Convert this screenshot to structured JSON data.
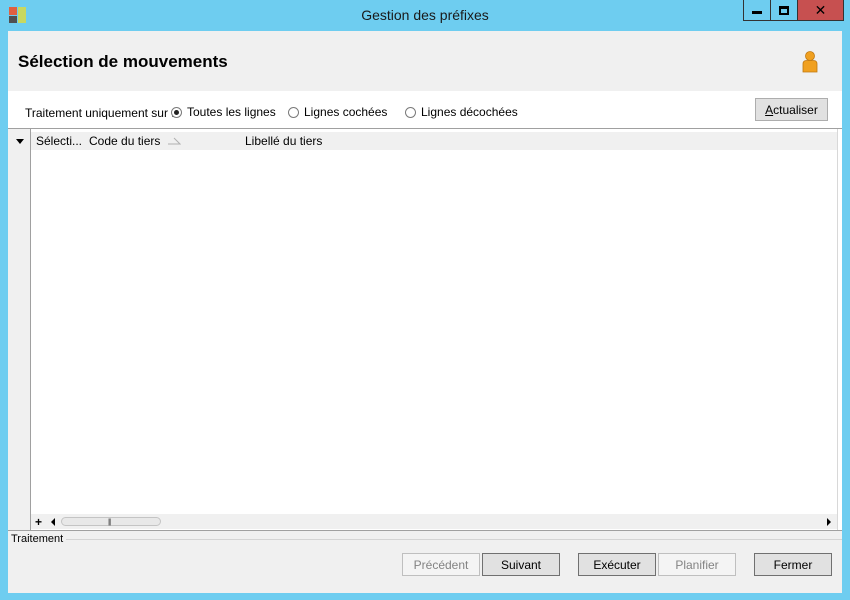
{
  "window": {
    "title": "Gestion des préfixes"
  },
  "header": {
    "title": "Sélection de mouvements",
    "user_icon": "user-icon",
    "user_icon_color": "#f0a020"
  },
  "options": {
    "label": "Traitement uniquement sur :",
    "radios": [
      {
        "label": "Toutes les lignes",
        "selected": true
      },
      {
        "label": "Lignes cochées",
        "selected": false
      },
      {
        "label": "Lignes décochées",
        "selected": false
      }
    ],
    "refresh_label": "Actualiser"
  },
  "grid": {
    "columns": [
      "Sélecti...",
      "Code du tiers",
      "Libellé du tiers"
    ],
    "rows": []
  },
  "status": {
    "label": "Traitement"
  },
  "buttons": {
    "previous": "Précédent",
    "next": "Suivant",
    "execute": "Exécuter",
    "schedule": "Planifier",
    "close": "Fermer"
  },
  "colors": {
    "title_bar": "#6ecdf0",
    "close_button": "#c75050"
  }
}
